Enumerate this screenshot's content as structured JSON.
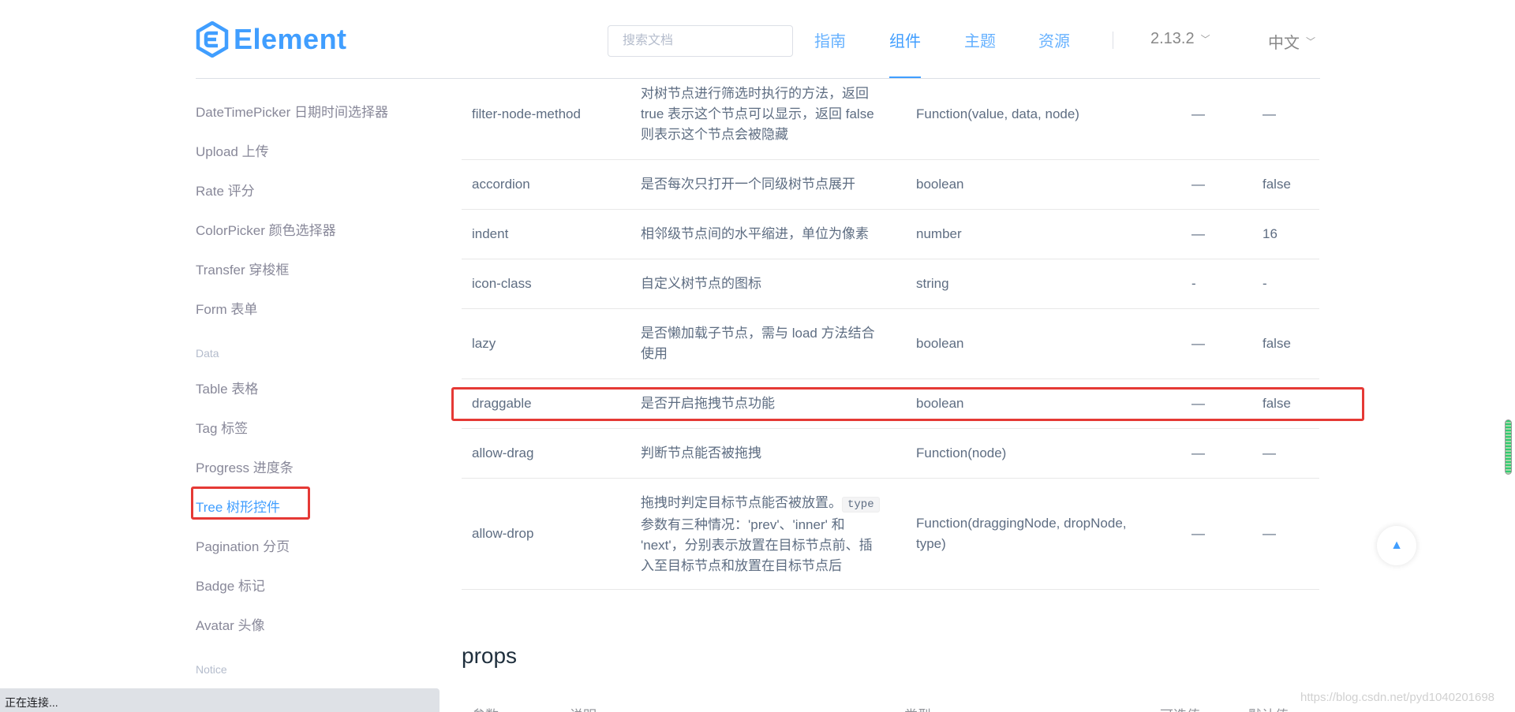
{
  "header": {
    "logo_text": "Element",
    "search_placeholder": "搜索文档",
    "nav": [
      {
        "label": "指南",
        "active": false
      },
      {
        "label": "组件",
        "active": true
      },
      {
        "label": "主题",
        "active": false
      },
      {
        "label": "资源",
        "active": false
      }
    ],
    "version": "2.13.2",
    "language": "中文"
  },
  "sidebar": {
    "items_top": [
      "DateTimePicker 日期时间选择器",
      "Upload 上传",
      "Rate 评分",
      "ColorPicker 颜色选择器",
      "Transfer 穿梭框",
      "Form 表单"
    ],
    "group_data": "Data",
    "items_data": [
      "Table 表格",
      "Tag 标签",
      "Progress 进度条",
      "Tree 树形控件",
      "Pagination 分页",
      "Badge 标记",
      "Avatar 头像"
    ],
    "active_item": "Tree 树形控件",
    "group_notice": "Notice"
  },
  "table": {
    "rows": [
      {
        "param": "filter-node-method",
        "desc": "对树节点进行筛选时执行的方法，返回 true 表示这个节点可以显示，返回 false 则表示这个节点会被隐藏",
        "type": "Function(value, data, node)",
        "options": "—",
        "default": "—"
      },
      {
        "param": "accordion",
        "desc": "是否每次只打开一个同级树节点展开",
        "type": "boolean",
        "options": "—",
        "default": "false"
      },
      {
        "param": "indent",
        "desc": "相邻级节点间的水平缩进，单位为像素",
        "type": "number",
        "options": "—",
        "default": "16"
      },
      {
        "param": "icon-class",
        "desc": "自定义树节点的图标",
        "type": "string",
        "options": "-",
        "default": "-"
      },
      {
        "param": "lazy",
        "desc": "是否懒加载子节点，需与 load 方法结合使用",
        "type": "boolean",
        "options": "—",
        "default": "false"
      },
      {
        "param": "draggable",
        "desc": "是否开启拖拽节点功能",
        "type": "boolean",
        "options": "—",
        "default": "false"
      },
      {
        "param": "allow-drag",
        "desc": "判断节点能否被拖拽",
        "type": "Function(node)",
        "options": "—",
        "default": "—"
      },
      {
        "param": "allow-drop",
        "desc_before": "拖拽时判定目标节点能否被放置。",
        "desc_code": "type",
        "desc_after": "参数有三种情况：'prev'、'inner' 和 'next'，分别表示放置在目标节点前、插入至目标节点和放置在目标节点后",
        "type": "Function(draggingNode, dropNode, type)",
        "options": "—",
        "default": "—"
      }
    ]
  },
  "props": {
    "title": "props",
    "headers": [
      "参数",
      "说明",
      "类型",
      "可选值",
      "默认值"
    ]
  },
  "status_text": "正在连接...",
  "watermark": "https://blog.csdn.net/pyd1040201698",
  "colors": {
    "accent": "#409eff",
    "highlight_box": "#e53935"
  }
}
